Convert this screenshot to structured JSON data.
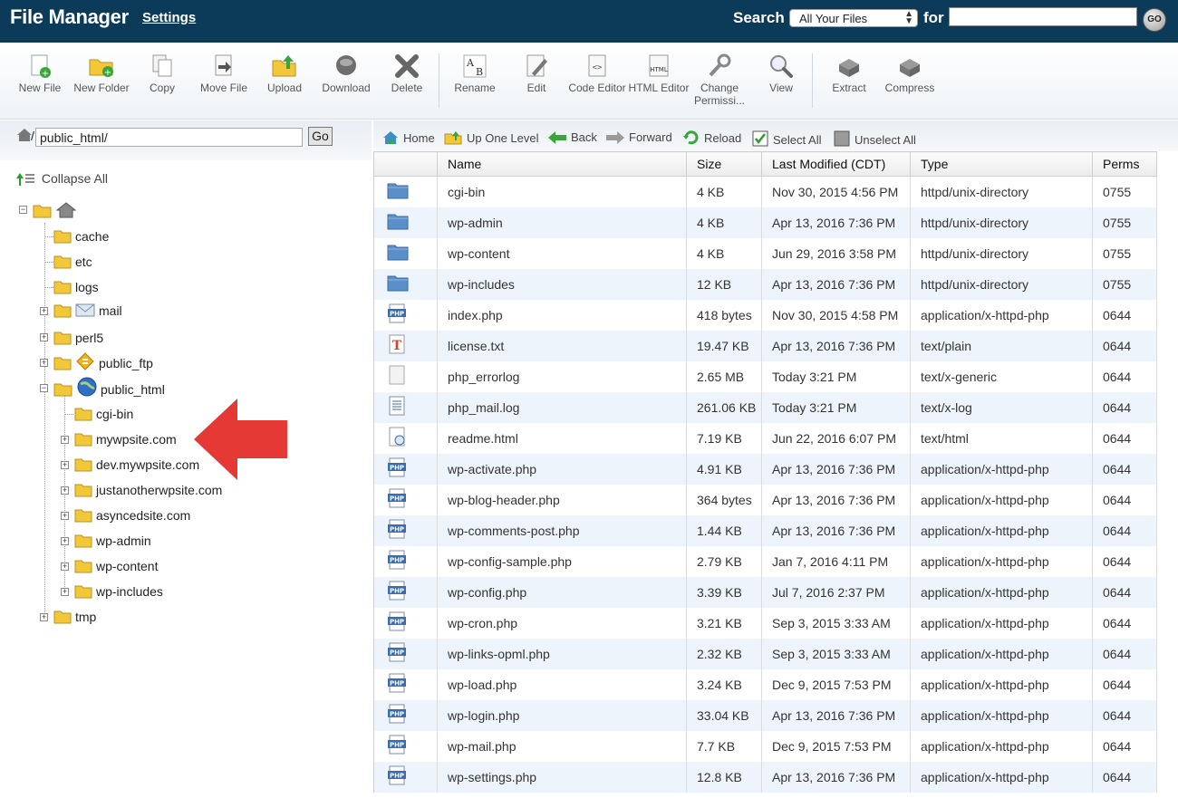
{
  "header": {
    "title": "File Manager",
    "settings": "Settings",
    "search_label": "Search",
    "search_scope": "All Your Files",
    "for_label": "for",
    "search_value": "",
    "go": "GO"
  },
  "toolbar": [
    {
      "label": "New File",
      "icon": "new-file-icon"
    },
    {
      "label": "New Folder",
      "icon": "new-folder-icon"
    },
    {
      "label": "Copy",
      "icon": "copy-icon"
    },
    {
      "label": "Move File",
      "icon": "move-file-icon"
    },
    {
      "label": "Upload",
      "icon": "upload-icon"
    },
    {
      "label": "Download",
      "icon": "download-icon"
    },
    {
      "label": "Delete",
      "icon": "delete-icon"
    },
    {
      "label": "Rename",
      "icon": "rename-icon"
    },
    {
      "label": "Edit",
      "icon": "edit-icon"
    },
    {
      "label": "Code Editor",
      "icon": "code-editor-icon"
    },
    {
      "label": "HTML Editor",
      "icon": "html-editor-icon"
    },
    {
      "label": "Change Permissi...",
      "icon": "permissions-icon"
    },
    {
      "label": "View",
      "icon": "view-icon"
    },
    {
      "label": "Extract",
      "icon": "extract-icon"
    },
    {
      "label": "Compress",
      "icon": "compress-icon"
    }
  ],
  "pathbar": {
    "prefix": "/",
    "path": "public_html/",
    "go": "Go"
  },
  "tree": {
    "collapse_all": "Collapse All",
    "items": [
      {
        "label": "cache"
      },
      {
        "label": "etc"
      },
      {
        "label": "logs"
      },
      {
        "label": "mail"
      },
      {
        "label": "perl5"
      },
      {
        "label": "public_ftp"
      },
      {
        "label": "public_html"
      },
      {
        "label": "cgi-bin"
      },
      {
        "label": "mywpsite.com"
      },
      {
        "label": "dev.mywpsite.com"
      },
      {
        "label": "justanotherwpsite.com"
      },
      {
        "label": "asyncedsite.com"
      },
      {
        "label": "wp-admin"
      },
      {
        "label": "wp-content"
      },
      {
        "label": "wp-includes"
      },
      {
        "label": "tmp"
      }
    ]
  },
  "nav": {
    "home": "Home",
    "up": "Up One Level",
    "back": "Back",
    "forward": "Forward",
    "reload": "Reload",
    "select_all": "Select All",
    "unselect_all": "Unselect All"
  },
  "table": {
    "columns": [
      "Name",
      "Size",
      "Last Modified (CDT)",
      "Type",
      "Perms"
    ],
    "rows": [
      {
        "icon": "folder",
        "name": "cgi-bin",
        "size": "4 KB",
        "modified": "Nov 30, 2015 4:56 PM",
        "type": "httpd/unix-directory",
        "perms": "0755"
      },
      {
        "icon": "folder",
        "name": "wp-admin",
        "size": "4 KB",
        "modified": "Apr 13, 2016 7:36 PM",
        "type": "httpd/unix-directory",
        "perms": "0755"
      },
      {
        "icon": "folder",
        "name": "wp-content",
        "size": "4 KB",
        "modified": "Jun 29, 2016 3:58 PM",
        "type": "httpd/unix-directory",
        "perms": "0755"
      },
      {
        "icon": "folder",
        "name": "wp-includes",
        "size": "12 KB",
        "modified": "Apr 13, 2016 7:36 PM",
        "type": "httpd/unix-directory",
        "perms": "0755"
      },
      {
        "icon": "php",
        "name": "index.php",
        "size": "418 bytes",
        "modified": "Nov 30, 2015 4:58 PM",
        "type": "application/x-httpd-php",
        "perms": "0644"
      },
      {
        "icon": "text",
        "name": "license.txt",
        "size": "19.47 KB",
        "modified": "Apr 13, 2016 7:36 PM",
        "type": "text/plain",
        "perms": "0644"
      },
      {
        "icon": "generic",
        "name": "php_errorlog",
        "size": "2.65 MB",
        "modified": "Today 3:21 PM",
        "type": "text/x-generic",
        "perms": "0644"
      },
      {
        "icon": "log",
        "name": "php_mail.log",
        "size": "261.06 KB",
        "modified": "Today 3:21 PM",
        "type": "text/x-log",
        "perms": "0644"
      },
      {
        "icon": "html",
        "name": "readme.html",
        "size": "7.19 KB",
        "modified": "Jun 22, 2016 6:07 PM",
        "type": "text/html",
        "perms": "0644"
      },
      {
        "icon": "php",
        "name": "wp-activate.php",
        "size": "4.91 KB",
        "modified": "Apr 13, 2016 7:36 PM",
        "type": "application/x-httpd-php",
        "perms": "0644"
      },
      {
        "icon": "php",
        "name": "wp-blog-header.php",
        "size": "364 bytes",
        "modified": "Apr 13, 2016 7:36 PM",
        "type": "application/x-httpd-php",
        "perms": "0644"
      },
      {
        "icon": "php",
        "name": "wp-comments-post.php",
        "size": "1.44 KB",
        "modified": "Apr 13, 2016 7:36 PM",
        "type": "application/x-httpd-php",
        "perms": "0644"
      },
      {
        "icon": "php",
        "name": "wp-config-sample.php",
        "size": "2.79 KB",
        "modified": "Jan 7, 2016 4:11 PM",
        "type": "application/x-httpd-php",
        "perms": "0644"
      },
      {
        "icon": "php",
        "name": "wp-config.php",
        "size": "3.39 KB",
        "modified": "Jul 7, 2016 2:37 PM",
        "type": "application/x-httpd-php",
        "perms": "0644"
      },
      {
        "icon": "php",
        "name": "wp-cron.php",
        "size": "3.21 KB",
        "modified": "Sep 3, 2015 3:33 AM",
        "type": "application/x-httpd-php",
        "perms": "0644"
      },
      {
        "icon": "php",
        "name": "wp-links-opml.php",
        "size": "2.32 KB",
        "modified": "Sep 3, 2015 3:33 AM",
        "type": "application/x-httpd-php",
        "perms": "0644"
      },
      {
        "icon": "php",
        "name": "wp-load.php",
        "size": "3.24 KB",
        "modified": "Dec 9, 2015 7:53 PM",
        "type": "application/x-httpd-php",
        "perms": "0644"
      },
      {
        "icon": "php",
        "name": "wp-login.php",
        "size": "33.04 KB",
        "modified": "Apr 13, 2016 7:36 PM",
        "type": "application/x-httpd-php",
        "perms": "0644"
      },
      {
        "icon": "php",
        "name": "wp-mail.php",
        "size": "7.7 KB",
        "modified": "Dec 9, 2015 7:53 PM",
        "type": "application/x-httpd-php",
        "perms": "0644"
      },
      {
        "icon": "php",
        "name": "wp-settings.php",
        "size": "12.8 KB",
        "modified": "Apr 13, 2016 7:36 PM",
        "type": "application/x-httpd-php",
        "perms": "0644"
      }
    ]
  },
  "colors": {
    "header_bg": "#0c3b5a",
    "row_alt": "#edf4fb",
    "annotation_arrow": "#e53935"
  }
}
